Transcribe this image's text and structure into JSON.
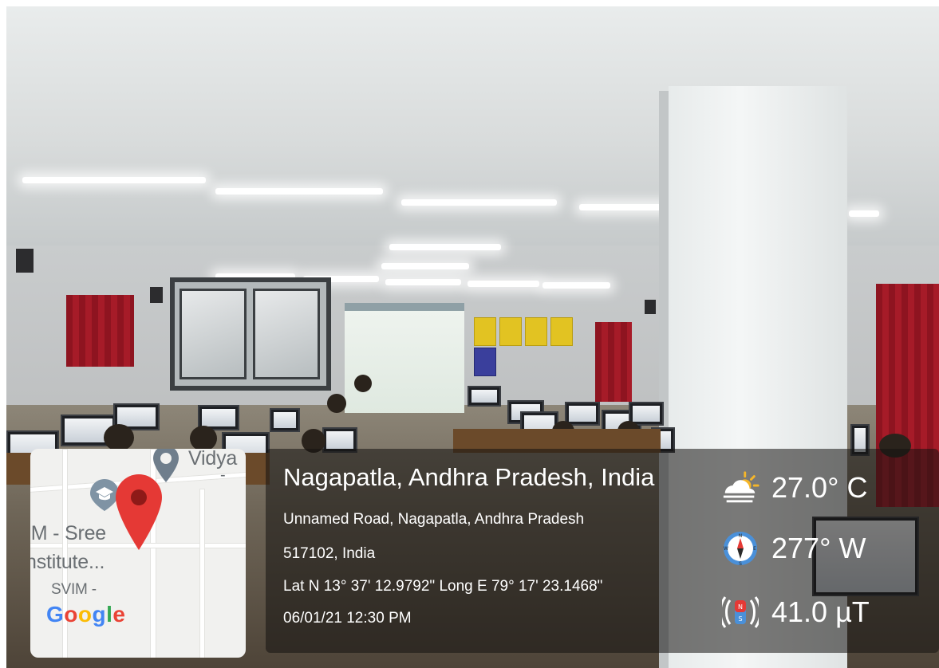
{
  "map": {
    "labels": {
      "top_place": "Vidya",
      "dash": "-",
      "institute_line1": "IM - Sree",
      "institute_line2": "nstitute...",
      "svim": "SVIM -"
    },
    "google_logo": {
      "letters": [
        "G",
        "o",
        "o",
        "g",
        "l",
        "e"
      ],
      "colors": [
        "#4285F4",
        "#EA4335",
        "#FBBC05",
        "#4285F4",
        "#34A853",
        "#EA4335"
      ]
    },
    "pin_color": "#e53935"
  },
  "location": {
    "title": "Nagapatla, Andhra Pradesh, India",
    "address_line1": "Unnamed Road, Nagapatla, Andhra Pradesh",
    "address_line2": "517102, India",
    "coordinates": "Lat N 13° 37' 12.9792\" Long E 79° 17' 23.1468\"",
    "datetime": "06/01/21 12:30 PM"
  },
  "metrics": {
    "temperature": {
      "value": "27.0° C",
      "icon": "partly-cloudy-icon"
    },
    "direction": {
      "value": "277° W",
      "icon": "compass-icon"
    },
    "magnetic": {
      "value": "41.0 µT",
      "icon": "magnet-icon"
    }
  }
}
